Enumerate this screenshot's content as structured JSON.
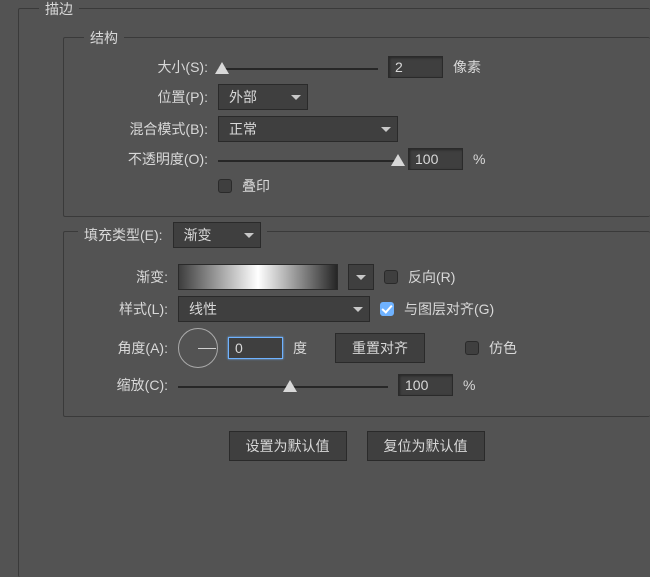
{
  "panel": {
    "title": "描边"
  },
  "structure": {
    "title": "结构",
    "size_label": "大小(S):",
    "size_value": "2",
    "size_unit": "像素",
    "position_label": "位置(P):",
    "position_value": "外部",
    "blend_label": "混合模式(B):",
    "blend_value": "正常",
    "opacity_label": "不透明度(O):",
    "opacity_value": "100",
    "opacity_unit": "%",
    "overprint_label": "叠印"
  },
  "fill": {
    "type_label": "填充类型(E):",
    "type_value": "渐变",
    "gradient_label": "渐变:",
    "reverse_label": "反向(R)",
    "style_label": "样式(L):",
    "style_value": "线性",
    "align_label": "与图层对齐(G)",
    "angle_label": "角度(A):",
    "angle_value": "0",
    "angle_unit": "度",
    "reset_align": "重置对齐",
    "dither_label": "仿色",
    "scale_label": "缩放(C):",
    "scale_value": "100",
    "scale_unit": "%"
  },
  "footer": {
    "set_default": "设置为默认值",
    "reset_default": "复位为默认值"
  }
}
